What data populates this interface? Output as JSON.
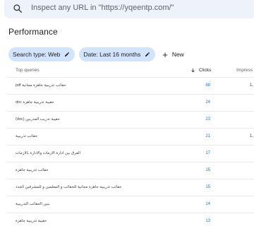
{
  "search": {
    "placeholder": "Inspect any URL in \"https://yqeentp.com/\""
  },
  "page_title": "Performance",
  "filters": {
    "chips": [
      {
        "label": "Search type: Web",
        "icon": "pencil-icon"
      },
      {
        "label": "Date: Last 16 months",
        "icon": "pencil-icon"
      }
    ],
    "new_label": "New"
  },
  "table": {
    "headers": {
      "query": "Top queries",
      "clicks": "Clicks",
      "impressions": "Impress"
    },
    "rows": [
      {
        "query": "حقائب تدريبية جاهزة مجانية pdf",
        "clicks": "88",
        "impressions": "1,"
      },
      {
        "query": "حقيبة تدريبية جاهزة doc",
        "clicks": "24",
        "impressions": ""
      },
      {
        "query": "حقيبة تدريب المدربين (doc)",
        "clicks": "23",
        "impressions": ""
      },
      {
        "query": "حقائب تدريبية",
        "clicks": "21",
        "impressions": "1,"
      },
      {
        "query": "الفرق بين ادارة الازمات والادارة بالازمات",
        "clicks": "17",
        "impressions": ""
      },
      {
        "query": "حقائب تدريبية جاهزة",
        "clicks": "15",
        "impressions": ""
      },
      {
        "query": "حقائب تدريبية جاهزة مجانية للحقائب و المعلمين و للمشرفين الجدد",
        "clicks": "15",
        "impressions": ""
      },
      {
        "query": "بنين الحقائب التدريبية",
        "clicks": "14",
        "impressions": ""
      },
      {
        "query": "حقيبة تدريبية جاهزة",
        "clicks": "13",
        "impressions": ""
      }
    ]
  },
  "colors": {
    "search_bg": "#eef2fb",
    "chip_bg": "#d2e3fc",
    "link_blue": "#1a73e8"
  }
}
